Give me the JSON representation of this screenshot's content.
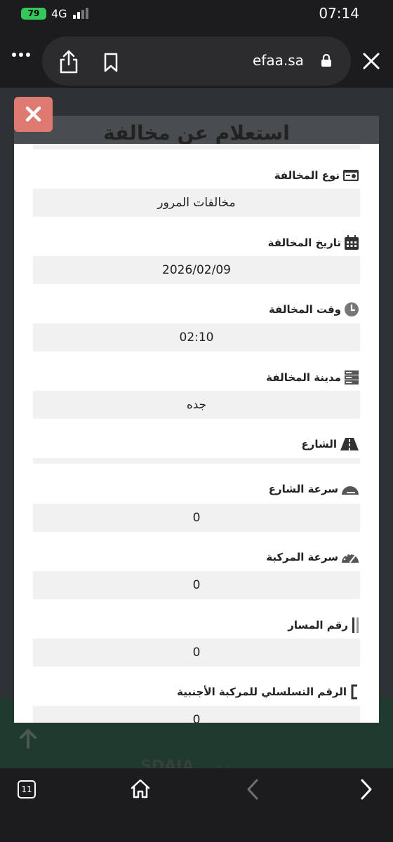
{
  "status_bar": {
    "battery": "79",
    "network": "4G",
    "time": "07:14"
  },
  "browser": {
    "url": "efaa.sa",
    "tab_count": "11"
  },
  "page_background": {
    "title": "استعلام عن مخالفة",
    "brand_left": "SDAIA",
    "brand_right": "نق"
  },
  "modal": {
    "fields": [
      {
        "label": "نوع المخالفة",
        "value": "مخالفات المرور",
        "icon": "id-card-icon"
      },
      {
        "label": "تاريخ المخالفة",
        "value": "2026/02/09",
        "icon": "calendar-icon"
      },
      {
        "label": "وقت المخالفة",
        "value": "02:10",
        "icon": "clock-icon"
      },
      {
        "label": "مدينة المخالفة",
        "value": "جده",
        "icon": "server-icon"
      },
      {
        "label": "الشارع",
        "value": "",
        "icon": "road-icon"
      },
      {
        "label": "سرعة الشارع",
        "value": "0",
        "icon": "speed-gauge-icon"
      },
      {
        "label": "سرعة المركبة",
        "value": "0",
        "icon": "speedometer-icon"
      },
      {
        "label": "رقم المسار",
        "value": "0",
        "icon": "lane-icon"
      },
      {
        "label": "الرقم التسلسلي للمركبة الأجنبية",
        "value": "0",
        "icon": "bracket-icon"
      }
    ]
  },
  "colors": {
    "modal_close": "#df7a72",
    "field_bg": "#f1f1f1",
    "battery": "#34c759"
  }
}
